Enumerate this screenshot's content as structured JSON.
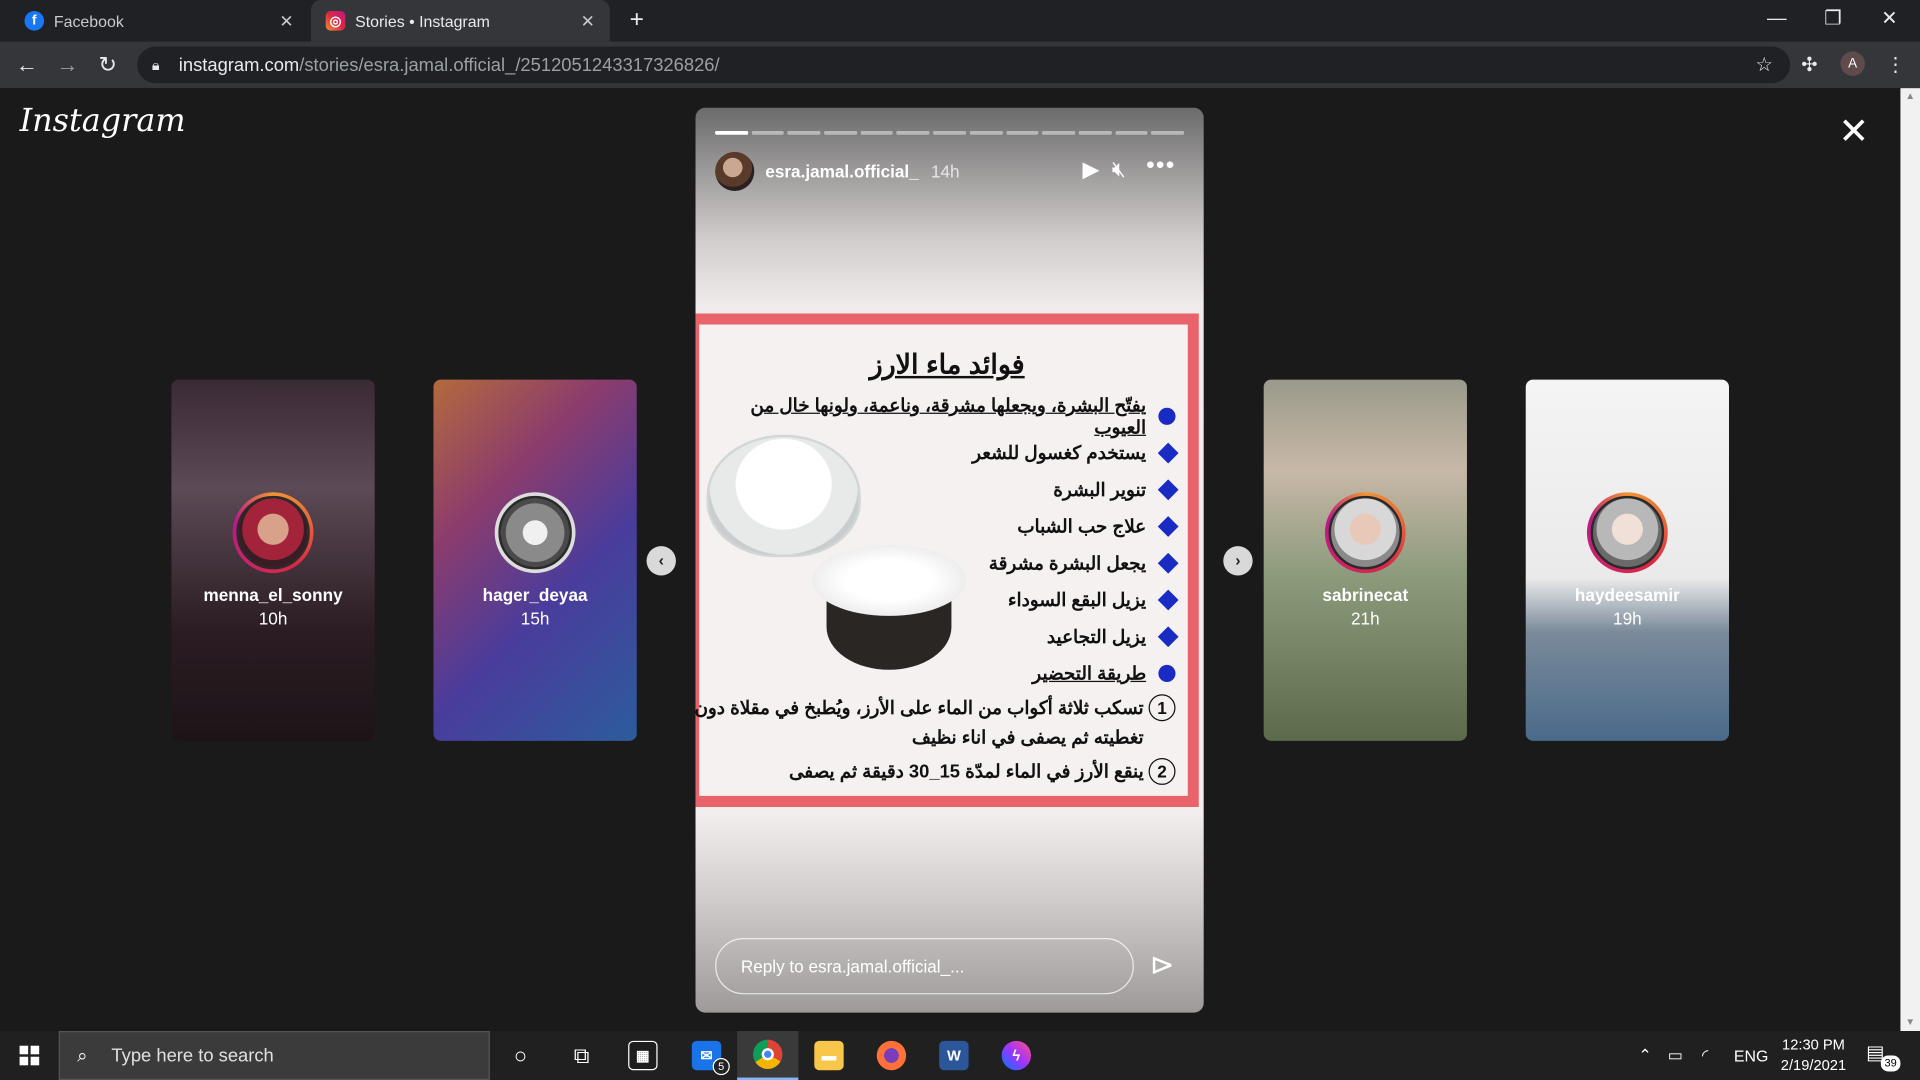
{
  "browser": {
    "tabs": [
      {
        "label": "Facebook",
        "favicon": "facebook-icon",
        "color": "#1877f2"
      },
      {
        "label": "Stories • Instagram",
        "favicon": "instagram-icon",
        "color": "#e1306c"
      }
    ],
    "url_host": "instagram.com",
    "url_path": "/stories/esra.jamal.official_/2512051243317326826/",
    "profile_initial": "A"
  },
  "instagram": {
    "logo": "Instagram",
    "side_stories": [
      {
        "name": "menna_el_sonny",
        "time": "10h"
      },
      {
        "name": "hager_deyaa",
        "time": "15h"
      },
      {
        "name": "sabrinecat",
        "time": "21h"
      },
      {
        "name": "haydeesamir",
        "time": "19h"
      }
    ],
    "story": {
      "user": "esra.jamal.official_",
      "time": "14h",
      "segments_total": 13,
      "segments_done": 1,
      "reply_placeholder": "Reply to esra.jamal.official_...",
      "card": {
        "title": "فوائد ماء الارز",
        "items": [
          "يفتّح البشرة، ويجعلها مشرقة، وناعمة، ولونها خال من العيوب",
          "يستخدم كغسول للشعر",
          "تنوير البشرة",
          "علاج حب الشباب",
          "يجعل البشرة مشرقة",
          "يزيل البقع السوداء",
          "يزيل التجاعيد",
          "طريقة التحضير"
        ],
        "steps": [
          {
            "num": "1",
            "text": "تسكب ثلاثة أكواب من الماء على الأرز، ويُطبخ في مقلاة دون تغطيته ثم يصفى في اناء نظيف"
          },
          {
            "num": "2",
            "text": "ينقع الأرز في الماء لمدّة 15_30 دقيقة ثم يصفى"
          }
        ]
      }
    }
  },
  "taskbar": {
    "search_placeholder": "Type here to search",
    "mail_badge": "5",
    "lang": "ENG",
    "time": "12:30 PM",
    "date": "2/19/2021",
    "notif_count": "39"
  }
}
